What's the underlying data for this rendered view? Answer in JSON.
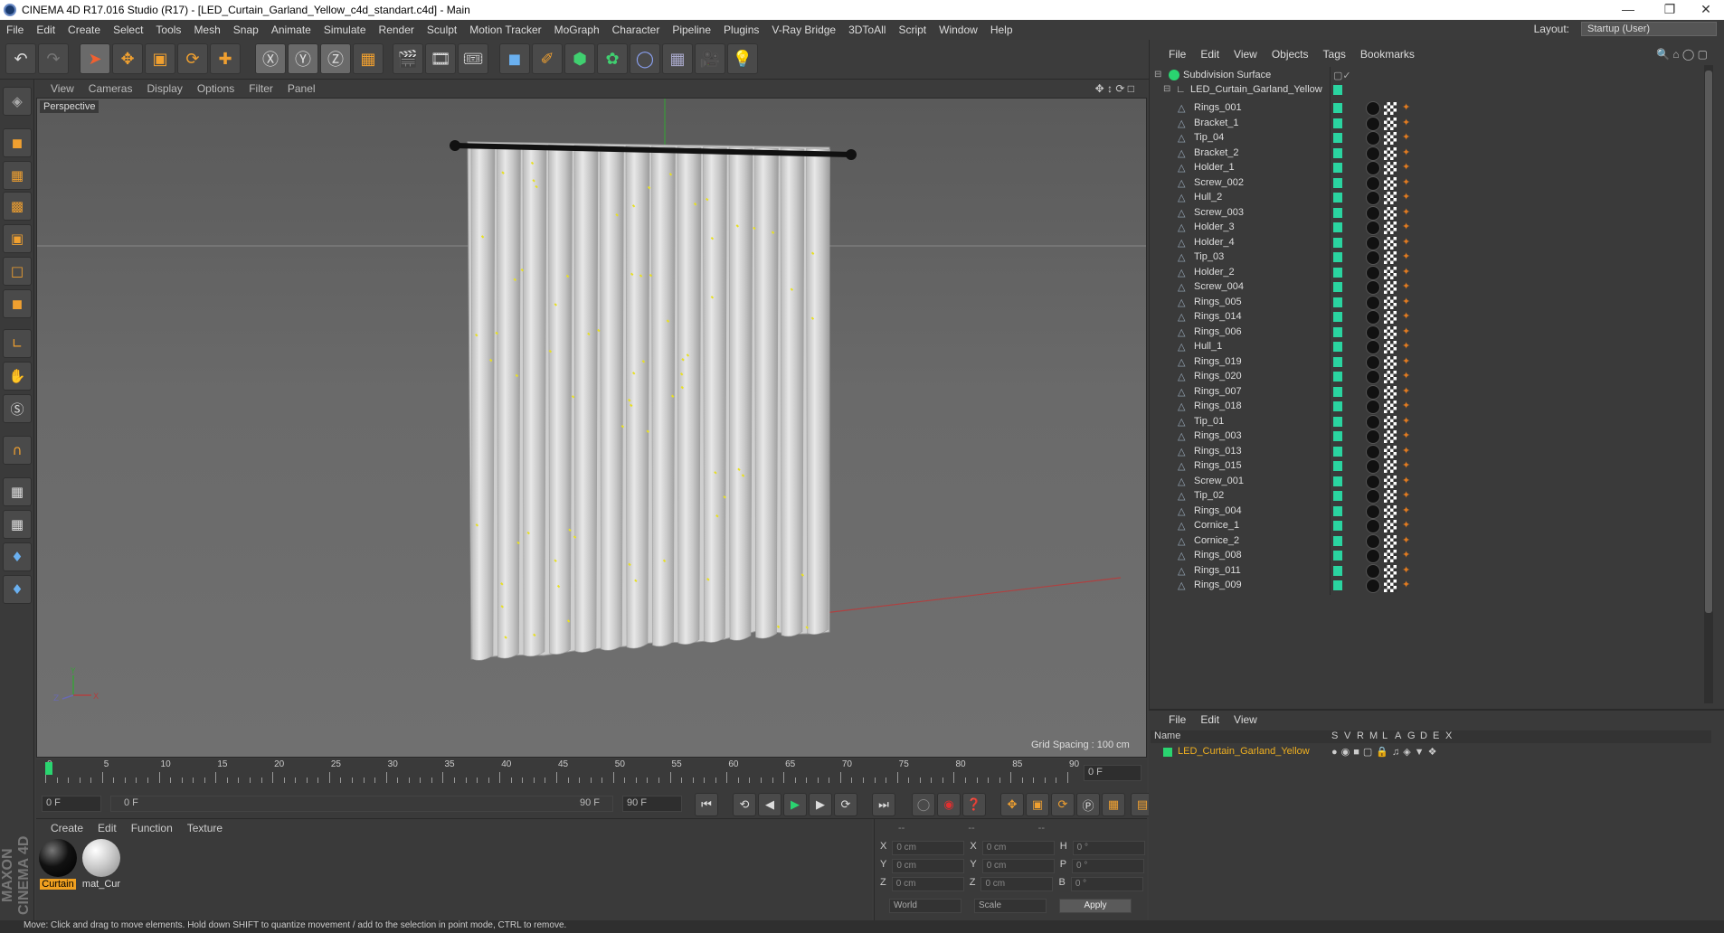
{
  "window": {
    "title": "CINEMA 4D R17.016 Studio (R17) - [LED_Curtain_Garland_Yellow_c4d_standart.c4d] - Main"
  },
  "menubar": [
    "File",
    "Edit",
    "Create",
    "Select",
    "Tools",
    "Mesh",
    "Snap",
    "Animate",
    "Simulate",
    "Render",
    "Sculpt",
    "Motion Tracker",
    "MoGraph",
    "Character",
    "Pipeline",
    "Plugins",
    "V-Ray Bridge",
    "3DToAll",
    "Script",
    "Window",
    "Help"
  ],
  "layout": {
    "label": "Layout:",
    "value": "Startup (User)"
  },
  "viewport": {
    "menu": [
      "View",
      "Cameras",
      "Display",
      "Options",
      "Filter",
      "Panel"
    ],
    "camera_label": "Perspective",
    "grid_spacing": "Grid Spacing : 100 cm",
    "axis_labels": {
      "x": "X",
      "y": "Y",
      "z": "Z"
    }
  },
  "timeline": {
    "ticks": [
      "0",
      "5",
      "10",
      "15",
      "20",
      "25",
      "30",
      "35",
      "40",
      "45",
      "50",
      "55",
      "60",
      "65",
      "70",
      "75",
      "80",
      "85",
      "90"
    ],
    "current_frame": "0 F",
    "start_field": "0 F",
    "range_start": "0 F",
    "range_end": "90 F",
    "end_field": "90 F"
  },
  "materials": {
    "menu": [
      "Create",
      "Edit",
      "Function",
      "Texture"
    ],
    "items": [
      {
        "name": "Curtain",
        "color": "#111111"
      },
      {
        "name": "mat_Cur",
        "color": "#d8d8d8"
      }
    ]
  },
  "coords": {
    "headers": [
      "--",
      "--",
      "--"
    ],
    "rows": [
      {
        "a": "X",
        "av": "0 cm",
        "b": "X",
        "bv": "0 cm",
        "c": "H",
        "cv": "0 °"
      },
      {
        "a": "Y",
        "av": "0 cm",
        "b": "Y",
        "bv": "0 cm",
        "c": "P",
        "cv": "0 °"
      },
      {
        "a": "Z",
        "av": "0 cm",
        "b": "Z",
        "bv": "0 cm",
        "c": "B",
        "cv": "0 °"
      }
    ],
    "world": "World",
    "scale": "Scale",
    "apply": "Apply"
  },
  "objects": {
    "menu": [
      "File",
      "Edit",
      "View",
      "Objects",
      "Tags",
      "Bookmarks"
    ],
    "root": "Subdivision Surface",
    "group": "LED_Curtain_Garland_Yellow",
    "children": [
      "Rings_001",
      "Bracket_1",
      "Tip_04",
      "Bracket_2",
      "Holder_1",
      "Screw_002",
      "Hull_2",
      "Screw_003",
      "Holder_3",
      "Holder_4",
      "Tip_03",
      "Holder_2",
      "Screw_004",
      "Rings_005",
      "Rings_014",
      "Rings_006",
      "Hull_1",
      "Rings_019",
      "Rings_020",
      "Rings_007",
      "Rings_018",
      "Tip_01",
      "Rings_003",
      "Rings_013",
      "Rings_015",
      "Screw_001",
      "Tip_02",
      "Rings_004",
      "Cornice_1",
      "Cornice_2",
      "Rings_008",
      "Rings_011",
      "Rings_009"
    ]
  },
  "attributes": {
    "menu": [
      "File",
      "Edit",
      "View"
    ],
    "columns": [
      "Name",
      "S",
      "V",
      "R",
      "M",
      "L",
      "A",
      "G",
      "D",
      "E",
      "X"
    ],
    "row": "LED_Curtain_Garland_Yellow"
  },
  "status": "Move: Click and drag to move elements. Hold down SHIFT to quantize movement / add to the selection in point mode, CTRL to remove.",
  "maxon": "MAXON CINEMA 4D"
}
